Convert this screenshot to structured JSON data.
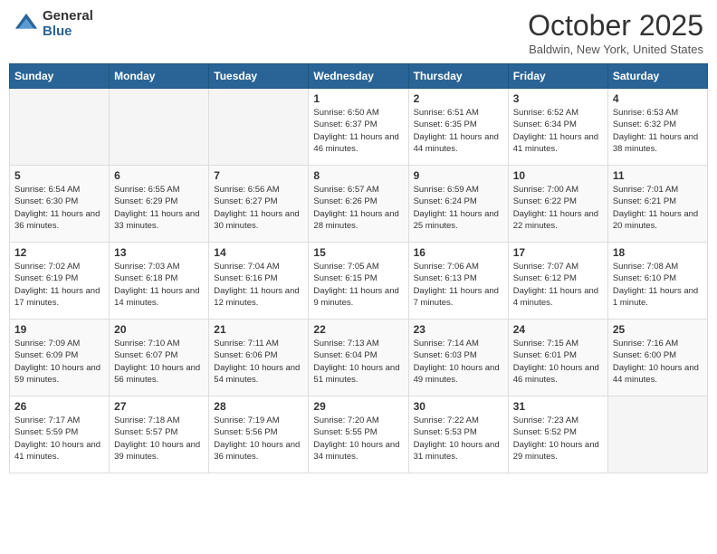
{
  "header": {
    "logo_general": "General",
    "logo_blue": "Blue",
    "month_title": "October 2025",
    "location": "Baldwin, New York, United States"
  },
  "calendar": {
    "days_of_week": [
      "Sunday",
      "Monday",
      "Tuesday",
      "Wednesday",
      "Thursday",
      "Friday",
      "Saturday"
    ],
    "weeks": [
      [
        {
          "day": "",
          "info": ""
        },
        {
          "day": "",
          "info": ""
        },
        {
          "day": "",
          "info": ""
        },
        {
          "day": "1",
          "info": "Sunrise: 6:50 AM\nSunset: 6:37 PM\nDaylight: 11 hours and 46 minutes."
        },
        {
          "day": "2",
          "info": "Sunrise: 6:51 AM\nSunset: 6:35 PM\nDaylight: 11 hours and 44 minutes."
        },
        {
          "day": "3",
          "info": "Sunrise: 6:52 AM\nSunset: 6:34 PM\nDaylight: 11 hours and 41 minutes."
        },
        {
          "day": "4",
          "info": "Sunrise: 6:53 AM\nSunset: 6:32 PM\nDaylight: 11 hours and 38 minutes."
        }
      ],
      [
        {
          "day": "5",
          "info": "Sunrise: 6:54 AM\nSunset: 6:30 PM\nDaylight: 11 hours and 36 minutes."
        },
        {
          "day": "6",
          "info": "Sunrise: 6:55 AM\nSunset: 6:29 PM\nDaylight: 11 hours and 33 minutes."
        },
        {
          "day": "7",
          "info": "Sunrise: 6:56 AM\nSunset: 6:27 PM\nDaylight: 11 hours and 30 minutes."
        },
        {
          "day": "8",
          "info": "Sunrise: 6:57 AM\nSunset: 6:26 PM\nDaylight: 11 hours and 28 minutes."
        },
        {
          "day": "9",
          "info": "Sunrise: 6:59 AM\nSunset: 6:24 PM\nDaylight: 11 hours and 25 minutes."
        },
        {
          "day": "10",
          "info": "Sunrise: 7:00 AM\nSunset: 6:22 PM\nDaylight: 11 hours and 22 minutes."
        },
        {
          "day": "11",
          "info": "Sunrise: 7:01 AM\nSunset: 6:21 PM\nDaylight: 11 hours and 20 minutes."
        }
      ],
      [
        {
          "day": "12",
          "info": "Sunrise: 7:02 AM\nSunset: 6:19 PM\nDaylight: 11 hours and 17 minutes."
        },
        {
          "day": "13",
          "info": "Sunrise: 7:03 AM\nSunset: 6:18 PM\nDaylight: 11 hours and 14 minutes."
        },
        {
          "day": "14",
          "info": "Sunrise: 7:04 AM\nSunset: 6:16 PM\nDaylight: 11 hours and 12 minutes."
        },
        {
          "day": "15",
          "info": "Sunrise: 7:05 AM\nSunset: 6:15 PM\nDaylight: 11 hours and 9 minutes."
        },
        {
          "day": "16",
          "info": "Sunrise: 7:06 AM\nSunset: 6:13 PM\nDaylight: 11 hours and 7 minutes."
        },
        {
          "day": "17",
          "info": "Sunrise: 7:07 AM\nSunset: 6:12 PM\nDaylight: 11 hours and 4 minutes."
        },
        {
          "day": "18",
          "info": "Sunrise: 7:08 AM\nSunset: 6:10 PM\nDaylight: 11 hours and 1 minute."
        }
      ],
      [
        {
          "day": "19",
          "info": "Sunrise: 7:09 AM\nSunset: 6:09 PM\nDaylight: 10 hours and 59 minutes."
        },
        {
          "day": "20",
          "info": "Sunrise: 7:10 AM\nSunset: 6:07 PM\nDaylight: 10 hours and 56 minutes."
        },
        {
          "day": "21",
          "info": "Sunrise: 7:11 AM\nSunset: 6:06 PM\nDaylight: 10 hours and 54 minutes."
        },
        {
          "day": "22",
          "info": "Sunrise: 7:13 AM\nSunset: 6:04 PM\nDaylight: 10 hours and 51 minutes."
        },
        {
          "day": "23",
          "info": "Sunrise: 7:14 AM\nSunset: 6:03 PM\nDaylight: 10 hours and 49 minutes."
        },
        {
          "day": "24",
          "info": "Sunrise: 7:15 AM\nSunset: 6:01 PM\nDaylight: 10 hours and 46 minutes."
        },
        {
          "day": "25",
          "info": "Sunrise: 7:16 AM\nSunset: 6:00 PM\nDaylight: 10 hours and 44 minutes."
        }
      ],
      [
        {
          "day": "26",
          "info": "Sunrise: 7:17 AM\nSunset: 5:59 PM\nDaylight: 10 hours and 41 minutes."
        },
        {
          "day": "27",
          "info": "Sunrise: 7:18 AM\nSunset: 5:57 PM\nDaylight: 10 hours and 39 minutes."
        },
        {
          "day": "28",
          "info": "Sunrise: 7:19 AM\nSunset: 5:56 PM\nDaylight: 10 hours and 36 minutes."
        },
        {
          "day": "29",
          "info": "Sunrise: 7:20 AM\nSunset: 5:55 PM\nDaylight: 10 hours and 34 minutes."
        },
        {
          "day": "30",
          "info": "Sunrise: 7:22 AM\nSunset: 5:53 PM\nDaylight: 10 hours and 31 minutes."
        },
        {
          "day": "31",
          "info": "Sunrise: 7:23 AM\nSunset: 5:52 PM\nDaylight: 10 hours and 29 minutes."
        },
        {
          "day": "",
          "info": ""
        }
      ]
    ]
  }
}
